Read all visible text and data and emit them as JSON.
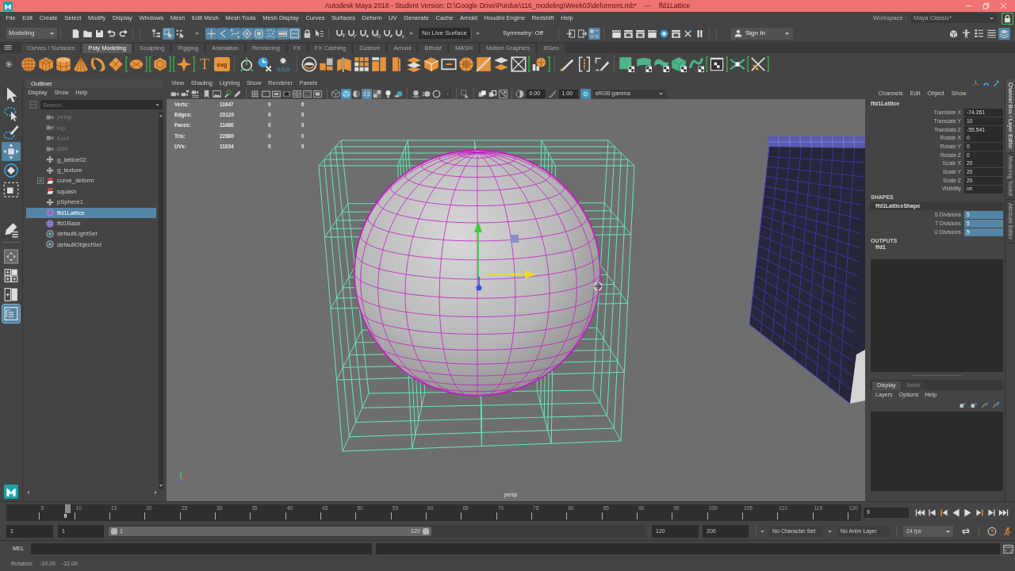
{
  "window": {
    "title": "Autodesk Maya 2018 - Student Version: D:\\Google Drive\\Purdue\\116_modeling\\Week03\\deformers.mb*    ---    ffd1Lattice"
  },
  "menu_bar": [
    "File",
    "Edit",
    "Create",
    "Select",
    "Modify",
    "Display",
    "Windows",
    "Mesh",
    "Edit Mesh",
    "Mesh Tools",
    "Mesh Display",
    "Curves",
    "Surfaces",
    "Deform",
    "UV",
    "Generate",
    "Cache",
    "Arnold",
    "Houdini Engine",
    "Redshift",
    "Help"
  ],
  "workspace": {
    "label": "Workspace :",
    "value": "Maya Classic*",
    "locked": true
  },
  "status_line": {
    "menu_set": "Modeling",
    "select_modes": [
      {
        "kind": "hierarchy",
        "on": false
      },
      {
        "kind": "object",
        "on": true
      },
      {
        "kind": "component",
        "on": false
      }
    ],
    "select_masks": [
      {
        "kind": "handle",
        "on": true
      },
      {
        "kind": "joint",
        "on": true
      },
      {
        "kind": "curve",
        "on": true
      },
      {
        "kind": "surface",
        "on": true
      },
      {
        "kind": "deformation",
        "on": true
      },
      {
        "kind": "dynamics",
        "on": true
      },
      {
        "kind": "rendering",
        "on": true
      },
      {
        "kind": "misc",
        "on": true
      }
    ],
    "select_options": [
      {
        "kind": "lock",
        "on": false
      },
      {
        "kind": "highlight",
        "on": false
      }
    ],
    "snaps": [
      {
        "kind": "grid",
        "on": false
      },
      {
        "kind": "curve",
        "on": false
      },
      {
        "kind": "point",
        "on": false
      },
      {
        "kind": "center",
        "on": false
      },
      {
        "kind": "viewplane",
        "on": false
      },
      {
        "kind": "live",
        "on": false
      }
    ],
    "live_surface": "No Live Surface",
    "symmetry": "Symmetry: Off",
    "history": [
      {
        "kind": "inputs",
        "on": false
      },
      {
        "kind": "outputs",
        "on": false
      },
      {
        "kind": "construction",
        "on": true
      }
    ],
    "sign_in": "Sign In",
    "panel_toggles": [
      {
        "kind": "toolkit",
        "on": false
      },
      {
        "kind": "character",
        "on": false
      },
      {
        "kind": "attributes",
        "on": false
      },
      {
        "kind": "tool_settings",
        "on": false
      },
      {
        "kind": "channel_box",
        "on": true
      }
    ]
  },
  "shelf": {
    "tabs": [
      {
        "label": "Curves / Surfaces",
        "selected": false
      },
      {
        "label": "Poly Modeling",
        "selected": true
      },
      {
        "label": "Sculpting",
        "selected": false
      },
      {
        "label": "Rigging",
        "selected": false
      },
      {
        "label": "Animation",
        "selected": false
      },
      {
        "label": "Rendering",
        "selected": false
      },
      {
        "label": "FX",
        "selected": false
      },
      {
        "label": "FX Caching",
        "selected": false
      },
      {
        "label": "Custom",
        "selected": false
      },
      {
        "label": "Arnold",
        "selected": false
      },
      {
        "label": "Bifrost",
        "selected": false
      },
      {
        "label": "MASH",
        "selected": false
      },
      {
        "label": "Motion Graphics",
        "selected": false
      },
      {
        "label": "XGen",
        "selected": false
      }
    ],
    "button_labels": [
      "T",
      "svg",
      "0,0,0"
    ]
  },
  "toolbox": {
    "tools": [
      {
        "kind": "select",
        "selected": false
      },
      {
        "kind": "lasso",
        "selected": false
      },
      {
        "kind": "paint",
        "selected": false
      },
      {
        "kind": "move",
        "selected": true
      },
      {
        "kind": "rotate",
        "selected": false
      },
      {
        "kind": "scale",
        "selected": false
      },
      {
        "kind": "last",
        "selected": false
      }
    ],
    "layouts": [
      {
        "kind": "manipulator",
        "selected": false
      },
      {
        "kind": "four",
        "selected": false
      },
      {
        "kind": "two",
        "selected": false
      },
      {
        "kind": "outliner",
        "selected": true
      }
    ]
  },
  "outliner": {
    "title": "Outliner",
    "menu": [
      "Display",
      "Show",
      "Help"
    ],
    "search": {
      "placeholder": "Search..."
    },
    "items": [
      {
        "label": "persp",
        "kind": "camera",
        "hidden": true,
        "collapsed": false,
        "selected": false
      },
      {
        "label": "top",
        "kind": "camera",
        "hidden": true,
        "collapsed": false,
        "selected": false
      },
      {
        "label": "front",
        "kind": "camera",
        "hidden": true,
        "collapsed": false,
        "selected": false
      },
      {
        "label": "side",
        "kind": "camera",
        "hidden": true,
        "collapsed": false,
        "selected": false
      },
      {
        "label": "g_lattice02",
        "kind": "transform",
        "hidden": false,
        "collapsed": false,
        "selected": false
      },
      {
        "label": "g_texture",
        "kind": "transform",
        "hidden": false,
        "collapsed": false,
        "selected": false
      },
      {
        "label": "curve_deform",
        "kind": "deformer",
        "hidden": false,
        "collapsed": true,
        "selected": false
      },
      {
        "label": "squash",
        "kind": "deformer",
        "hidden": false,
        "collapsed": false,
        "selected": false
      },
      {
        "label": "pSphere1",
        "kind": "transform",
        "hidden": false,
        "collapsed": false,
        "selected": false
      },
      {
        "label": "ffd1Lattice",
        "kind": "lattice",
        "hidden": false,
        "collapsed": false,
        "selected": true
      },
      {
        "label": "ffd1Base",
        "kind": "lattice",
        "hidden": false,
        "collapsed": false,
        "selected": false
      },
      {
        "label": "defaultLightSet",
        "kind": "set",
        "hidden": false,
        "collapsed": false,
        "selected": false
      },
      {
        "label": "defaultObjectSet",
        "kind": "set",
        "hidden": false,
        "collapsed": false,
        "selected": false
      }
    ]
  },
  "viewport": {
    "menu": [
      "View",
      "Shading",
      "Lighting",
      "Show",
      "Renderer",
      "Panels"
    ],
    "toolbar": [
      {
        "kind": "camera",
        "on": false
      },
      {
        "kind": "camera_lock",
        "on": false
      },
      {
        "kind": "camera_attributes",
        "on": false
      },
      {
        "kind": "bookmark",
        "on": false
      },
      {
        "kind": "image_plane",
        "on": false
      },
      {
        "kind": "pan_zoom",
        "on": false
      },
      {
        "kind": "grease_pencil",
        "on": false
      },
      {
        "kind": "grid",
        "on": false
      },
      {
        "kind": "film_gate",
        "on": false
      },
      {
        "kind": "resolution_gate",
        "on": false
      },
      {
        "kind": "gate_mask",
        "on": false
      },
      {
        "kind": "field_chart",
        "on": false
      },
      {
        "kind": "safe_action",
        "on": false
      },
      {
        "kind": "safe_title",
        "on": false
      },
      {
        "kind": "wireframe",
        "on": false
      },
      {
        "kind": "smooth_shade",
        "on": true
      },
      {
        "kind": "default_material",
        "on": false
      },
      {
        "kind": "wireframe_on_shaded",
        "on": true
      },
      {
        "kind": "textured",
        "on": false
      },
      {
        "kind": "all_lights",
        "on": false
      },
      {
        "kind": "shadows",
        "on": false
      },
      {
        "kind": "ambient_occlusion",
        "on": false
      },
      {
        "kind": "motion_blur",
        "on": false
      },
      {
        "kind": "anti_aliasing",
        "on": false
      },
      {
        "kind": "depth_of_field",
        "on": false
      },
      {
        "kind": "isolate_select",
        "on": false
      },
      {
        "kind": "xray",
        "on": false
      },
      {
        "kind": "xray_active",
        "on": false
      },
      {
        "kind": "xray_joints",
        "on": false
      }
    ],
    "exposure": "0.00",
    "gamma": "1.00",
    "color_managed": true,
    "color_space": "sRGB gamma",
    "hud": [
      {
        "label": "Verts:",
        "values": [
          "11647",
          "0",
          "0"
        ]
      },
      {
        "label": "Edges:",
        "values": [
          "23120",
          "0",
          "0"
        ]
      },
      {
        "label": "Faces:",
        "values": [
          "11480",
          "0",
          "0"
        ]
      },
      {
        "label": "Tris:",
        "values": [
          "22880",
          "0",
          "0"
        ]
      },
      {
        "label": "UVs:",
        "values": [
          "11834",
          "0",
          "0"
        ]
      }
    ],
    "camera": "persp"
  },
  "channel_box": {
    "menu": [
      "Channels",
      "Edit",
      "Object",
      "Show"
    ],
    "object": "ffd1Lattice",
    "channels": [
      {
        "label": "Translate X",
        "value": "-74.261",
        "selected": false
      },
      {
        "label": "Translate Y",
        "value": "10",
        "selected": false
      },
      {
        "label": "Translate Z",
        "value": "-55.541",
        "selected": false
      },
      {
        "label": "Rotate X",
        "value": "0",
        "selected": false
      },
      {
        "label": "Rotate Y",
        "value": "0",
        "selected": false
      },
      {
        "label": "Rotate Z",
        "value": "0",
        "selected": false
      },
      {
        "label": "Scale X",
        "value": "20",
        "selected": false
      },
      {
        "label": "Scale Y",
        "value": "20",
        "selected": false
      },
      {
        "label": "Scale Z",
        "value": "20",
        "selected": false
      },
      {
        "label": "Visibility",
        "value": "on",
        "selected": false
      }
    ],
    "shapes_heading": "SHAPES",
    "shape": "ffd1LatticeShape",
    "shape_channels": [
      {
        "label": "S Divisions",
        "value": "5",
        "selected": true
      },
      {
        "label": "T Divisions",
        "value": "5",
        "selected": true
      },
      {
        "label": "U Divisions",
        "value": "5",
        "selected": true
      }
    ],
    "outputs_heading": "OUTPUTS",
    "outputs": [
      "ffd1"
    ]
  },
  "layer_editor": {
    "tabs": [
      {
        "label": "Display",
        "selected": true
      },
      {
        "label": "Anim",
        "selected": false
      }
    ],
    "menu": [
      "Layers",
      "Options",
      "Help"
    ]
  },
  "side_tabs": [
    {
      "label": "Channel Box / Layer Editor",
      "selected": true
    },
    {
      "label": "Modeling Toolkit",
      "selected": false
    },
    {
      "label": "Attribute Editor",
      "selected": false
    }
  ],
  "time_slider": {
    "ticks": [
      "5",
      "10",
      "15",
      "20",
      "25",
      "30",
      "35",
      "40",
      "45",
      "50",
      "55",
      "60",
      "65",
      "70",
      "75",
      "80",
      "85",
      "90",
      "95",
      "100",
      "105",
      "110",
      "115",
      "120"
    ],
    "level": 0.072,
    "current_frame": "9",
    "current_time": "9"
  },
  "range_slider": {
    "start": "1",
    "playback_start": "1",
    "bar_start": "1",
    "bar_end": "120",
    "level": 0.6,
    "playback_end": "120",
    "end": "200",
    "character_set": "No Character Set",
    "anim_layer": "No Anim Layer",
    "fps": "24 fps"
  },
  "command_line": {
    "language": "MEL"
  },
  "help_line": {
    "label": "Rotation:",
    "values": [
      "-10.00",
      "-12.00"
    ]
  }
}
